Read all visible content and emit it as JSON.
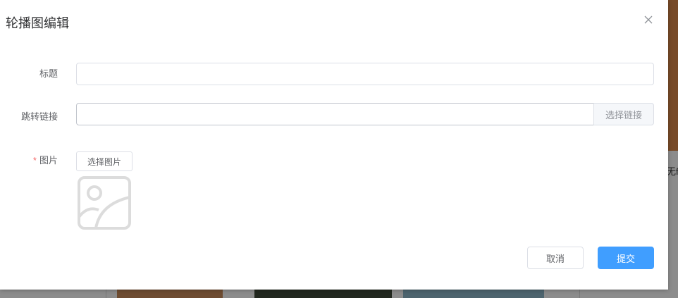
{
  "dialog": {
    "title": "轮播图编辑",
    "close_icon": "close-icon"
  },
  "background": {
    "peek_text": "无f"
  },
  "form": {
    "title_field": {
      "label": "标题",
      "value": "",
      "placeholder": ""
    },
    "link_field": {
      "label": "跳转链接",
      "value": "",
      "placeholder": "",
      "append_button": "选择链接"
    },
    "image_field": {
      "required_mark": "*",
      "label": "图片",
      "select_button": "选择图片",
      "placeholder_icon": "image-placeholder-icon"
    }
  },
  "footer": {
    "cancel_label": "取消",
    "submit_label": "提交"
  },
  "colors": {
    "primary": "#409eff",
    "required": "#f56c6c",
    "border": "#dcdfe6",
    "text": "#606266"
  }
}
